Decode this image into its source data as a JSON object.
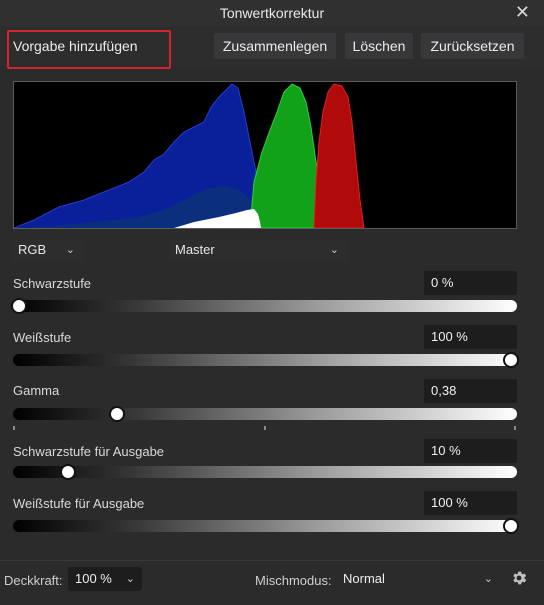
{
  "window": {
    "title": "Tonwertkorrektur"
  },
  "toolbar": {
    "preset_label": "Vorgabe hinzufügen",
    "merge_label": "Zusammenlegen",
    "delete_label": "Löschen",
    "reset_label": "Zurücksetzen"
  },
  "histogram": {
    "colors": {
      "blue": "#0a1f9a",
      "green": "#11a21a",
      "red": "#b00a0a",
      "white": "#ffffff"
    }
  },
  "channel_select": {
    "value": "RGB"
  },
  "mode_select": {
    "value": "Master"
  },
  "controls": [
    {
      "label": "Schwarzstufe",
      "value": "0 %",
      "level": 0.0
    },
    {
      "label": "Weißstufe",
      "value": "100 %",
      "level": 1.0
    },
    {
      "label": "Gamma",
      "value": "0,38",
      "level": 0.2
    },
    {
      "label": "Schwarzstufe für Ausgabe",
      "value": "10 %",
      "level": 0.1
    },
    {
      "label": "Weißstufe für Ausgabe",
      "value": "100 %",
      "level": 1.0
    }
  ],
  "footer": {
    "opacity_label": "Deckkraft:",
    "opacity_value": "100 %",
    "blend_label": "Mischmodus:",
    "blend_value": "Normal"
  },
  "icons": {
    "close": "close-icon",
    "settings": "gear-icon",
    "dropdown": "chevron-down-icon"
  },
  "accent": {
    "highlight_border": "#d3262c"
  }
}
